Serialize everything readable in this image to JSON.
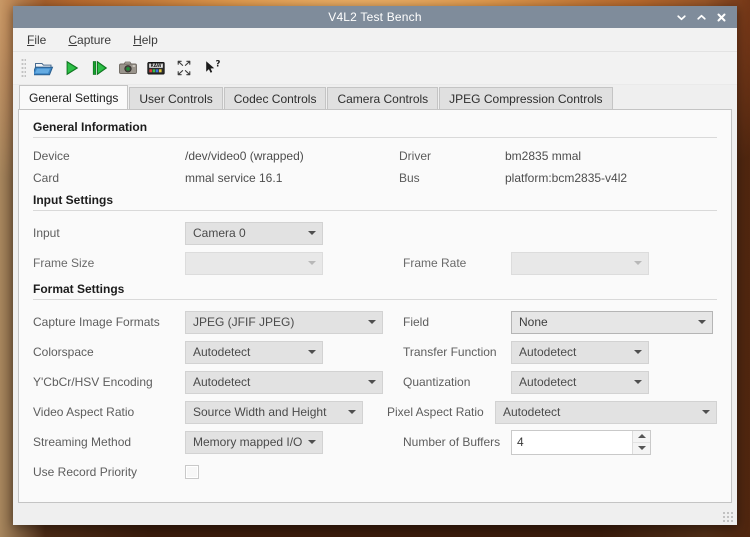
{
  "window": {
    "title": "V4L2 Test Bench",
    "controls": [
      {
        "name": "minimize",
        "glyph": "chevron-down"
      },
      {
        "name": "maximize",
        "glyph": "chevron-up"
      },
      {
        "name": "close",
        "glyph": "x"
      }
    ]
  },
  "menubar": {
    "items": [
      {
        "mnemonic": "F",
        "rest": "ile"
      },
      {
        "mnemonic": "C",
        "rest": "apture"
      },
      {
        "mnemonic": "H",
        "rest": "elp"
      }
    ]
  },
  "toolbar": {
    "buttons": [
      {
        "icon": "open-folder-icon",
        "title": "Open"
      },
      {
        "icon": "play-icon",
        "title": "Start Capture"
      },
      {
        "icon": "step-icon",
        "title": "Step"
      },
      {
        "icon": "camera-icon",
        "title": "Snapshot"
      },
      {
        "icon": "raw-icon",
        "title": "Save Raw"
      },
      {
        "icon": "fullscreen-icon",
        "title": "Fullscreen"
      },
      {
        "icon": "whats-this-icon",
        "title": "What's This"
      }
    ]
  },
  "tabs": [
    {
      "label": "General Settings",
      "active": true
    },
    {
      "label": "User Controls",
      "active": false
    },
    {
      "label": "Codec Controls",
      "active": false
    },
    {
      "label": "Camera Controls",
      "active": false
    },
    {
      "label": "JPEG Compression Controls",
      "active": false
    }
  ],
  "sections": {
    "general_information": {
      "title": "General Information",
      "rows": [
        {
          "label": "Device",
          "value": "/dev/video0 (wrapped)",
          "label2": "Driver",
          "value2": "bm2835 mmal"
        },
        {
          "label": "Card",
          "value": "mmal service 16.1",
          "label2": "Bus",
          "value2": "platform:bcm2835-v4l2"
        }
      ]
    },
    "input_settings": {
      "title": "Input Settings",
      "input_label": "Input",
      "input_value": "Camera 0",
      "frame_size_label": "Frame Size",
      "frame_size_value": "",
      "frame_rate_label": "Frame Rate",
      "frame_rate_value": ""
    },
    "format_settings": {
      "title": "Format Settings",
      "capture_image_formats_label": "Capture Image Formats",
      "capture_image_formats_value": "JPEG (JFIF JPEG)",
      "field_label": "Field",
      "field_value": "None",
      "colorspace_label": "Colorspace",
      "colorspace_value": "Autodetect",
      "transfer_function_label": "Transfer Function",
      "transfer_function_value": "Autodetect",
      "ycbcr_label": "Y'CbCr/HSV Encoding",
      "ycbcr_value": "Autodetect",
      "quantization_label": "Quantization",
      "quantization_value": "Autodetect",
      "video_aspect_ratio_label": "Video Aspect Ratio",
      "video_aspect_ratio_value": "Source Width and Height",
      "pixel_aspect_ratio_label": "Pixel Aspect Ratio",
      "pixel_aspect_ratio_value": "Autodetect",
      "streaming_method_label": "Streaming Method",
      "streaming_method_value": "Memory mapped I/O",
      "number_of_buffers_label": "Number of Buffers",
      "number_of_buffers_value": "4",
      "use_record_priority_label": "Use Record Priority",
      "use_record_priority_checked": false
    }
  },
  "colors": {
    "titlebar": "#7f8c9b",
    "window_bg": "#efefef",
    "panel_bg": "#fafafa",
    "combo_bg": "#e2e2e2",
    "text": "#4d4d4d",
    "accent_green": "#1f9e36",
    "desktop": "#b0622a"
  }
}
